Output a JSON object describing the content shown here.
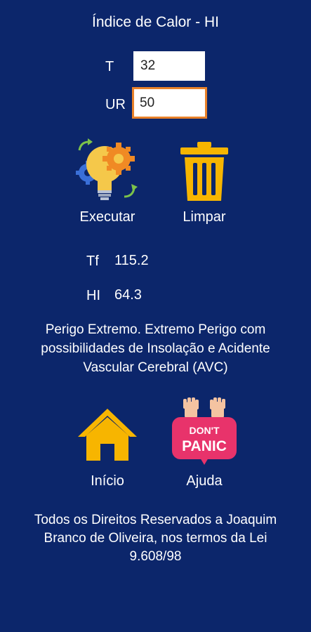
{
  "title": "Índice de Calor - HI",
  "inputs": {
    "t_label": "T",
    "t_value": "32",
    "ur_label": "UR",
    "ur_value": "50"
  },
  "actions": {
    "execute_label": "Executar",
    "clear_label": "Limpar"
  },
  "results": {
    "tf_label": "Tf",
    "tf_value": "115.2",
    "hi_label": "HI",
    "hi_value": "64.3"
  },
  "message": "Perigo Extremo. Extremo Perigo com possibilidades de Insolação e Acidente Vascular Cerebral (AVC)",
  "nav": {
    "home_label": "Início",
    "help_label": "Ajuda",
    "dont_panic_line1": "DON'T",
    "dont_panic_line2": "PANIC"
  },
  "footer": "Todos os Direitos Reservados a Joaquim Branco de Oliveira, nos termos da Lei 9.608/98",
  "colors": {
    "background": "#0c266b",
    "focus_border": "#e8812a",
    "icon_yellow": "#f7b500",
    "panic_pink": "#e8336b"
  }
}
